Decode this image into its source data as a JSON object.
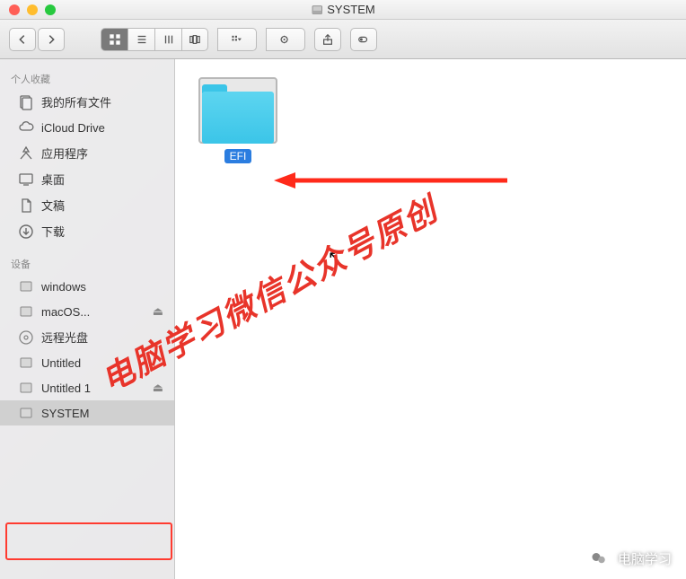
{
  "window": {
    "title": "SYSTEM"
  },
  "sidebar": {
    "favorites_header": "个人收藏",
    "devices_header": "设备",
    "favorites": [
      {
        "icon": "all-files",
        "label": "我的所有文件"
      },
      {
        "icon": "cloud",
        "label": "iCloud Drive"
      },
      {
        "icon": "apps",
        "label": "应用程序"
      },
      {
        "icon": "desktop",
        "label": "桌面"
      },
      {
        "icon": "documents",
        "label": "文稿"
      },
      {
        "icon": "downloads",
        "label": "下载"
      }
    ],
    "devices": [
      {
        "icon": "disk",
        "label": "windows",
        "eject": false
      },
      {
        "icon": "disk",
        "label": "macOS...",
        "eject": true
      },
      {
        "icon": "disc",
        "label": "远程光盘",
        "eject": false
      },
      {
        "icon": "disk",
        "label": "Untitled",
        "eject": false
      },
      {
        "icon": "disk",
        "label": "Untitled 1",
        "eject": true
      },
      {
        "icon": "disk",
        "label": "SYSTEM",
        "eject": false,
        "selected": true
      }
    ]
  },
  "content": {
    "items": [
      {
        "type": "folder",
        "label": "EFI",
        "selected": true
      }
    ]
  },
  "annotations": {
    "watermark_text": "电脑学习微信公众号原创",
    "footer_text": "电脑学习"
  }
}
